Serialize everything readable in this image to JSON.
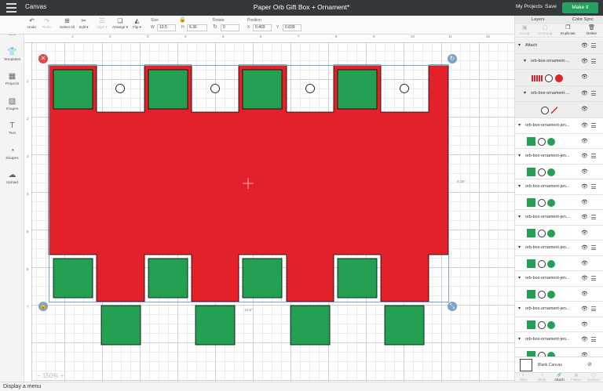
{
  "topbar": {
    "app": "Canvas",
    "title": "Paper Orb Gift Box + Ornament*",
    "my_projects": "My Projects",
    "save": "Save",
    "make_it": "Make It"
  },
  "toolbar": {
    "undo": "Undo",
    "redo": "Redo",
    "select_all": "Select All",
    "edit": "Edit ▾",
    "align": "Align ▾",
    "arrange": "Arrange ▾",
    "flip": "Flip ▾",
    "size_label": "Size",
    "w_label": "W",
    "w_value": "10.5",
    "h_label": "H",
    "h_value": "6.36",
    "rotate_label": "Rotate",
    "rotate_value": "0",
    "position_label": "Position",
    "x_label": "X",
    "x_value": "0.469",
    "y_label": "Y",
    "y_value": "0.839"
  },
  "sidebar": [
    "New",
    "Templates",
    "Projects",
    "Images",
    "Text",
    "Shapes",
    "Upload"
  ],
  "ruler": {
    "top": [
      "1",
      "2",
      "3",
      "4",
      "5",
      "6",
      "7",
      "8",
      "9",
      "10",
      "11",
      "12"
    ],
    "left": [
      "1",
      "2",
      "3",
      "4",
      "5",
      "6",
      "7"
    ]
  },
  "canvas": {
    "width_label": "10.5\"",
    "height_label": "6.36\"",
    "zoom": "150%",
    "colors": {
      "red": "#e3212a",
      "green": "#24a052",
      "stroke": "#000000"
    }
  },
  "status": "Display a menu",
  "layers": {
    "tab_layers": "Layers",
    "tab_color_sync": "Color Sync",
    "tools": [
      {
        "label": "Group",
        "on": false
      },
      {
        "label": "UnGroup",
        "on": false
      },
      {
        "label": "Duplicate",
        "on": true
      },
      {
        "label": "Delete",
        "on": true
      }
    ],
    "group_label": "Attach",
    "subgroups": [
      {
        "name": "orb-box-ornament-...",
        "swatches": [
          "red-strip",
          "outline",
          "red-dot"
        ]
      },
      {
        "name": "orb-box-ornament-...",
        "swatches": [
          "outline",
          "red-line"
        ]
      }
    ],
    "items": [
      "orb-box-ornament-jen...",
      "orb-box-ornament-jen...",
      "orb-box-ornament-jen...",
      "orb-box-ornament-jen...",
      "orb-box-ornament-jen...",
      "orb-box-ornament-jen...",
      "orb-box-ornament-jen...",
      "orb-box-ornament-jen..."
    ],
    "blank_canvas": "Blank Canvas",
    "bottom_tools": [
      "Slice",
      "Weld",
      "Attach",
      "Flatten",
      "Contour"
    ]
  }
}
